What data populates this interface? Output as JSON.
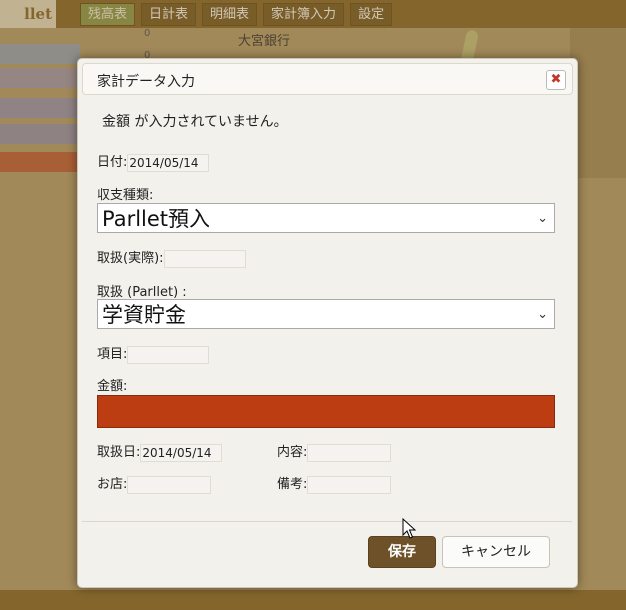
{
  "app": {
    "logo_text": "llet",
    "nav_tabs": [
      {
        "label": "残高表",
        "active": true
      },
      {
        "label": "日計表",
        "active": false
      },
      {
        "label": "明細表",
        "active": false
      },
      {
        "label": "家計簿入力",
        "active": false
      },
      {
        "label": "設定",
        "active": false
      }
    ],
    "background_bank": "大宮銀行",
    "background_zero": "0"
  },
  "dialog": {
    "title": "家計データ入力",
    "close_glyph": "✖",
    "error_message": "金額 が入力されていません。",
    "date_label": "日付:",
    "date_value": "2014/05/14",
    "type_label": "収支種類:",
    "type_value": "Parllet預入",
    "handler_actual_label": "取扱(実際):",
    "handler_actual_value": "",
    "handler_parllet_label": "取扱 (Parllet) :",
    "handler_parllet_value": "学資貯金",
    "item_label": "項目:",
    "item_value": "",
    "amount_label": "金額:",
    "amount_value": "",
    "handled_date_label": "取扱日:",
    "handled_date_value": "2014/05/14",
    "content_label": "内容:",
    "content_value": "",
    "shop_label": "お店:",
    "shop_value": "",
    "note_label": "備考:",
    "note_value": "",
    "save_label": "保存",
    "cancel_label": "キャンセル"
  },
  "colors": {
    "amount_error": "#bd3d12",
    "save_button": "#6e5128",
    "topbar": "#8a6a2a"
  }
}
